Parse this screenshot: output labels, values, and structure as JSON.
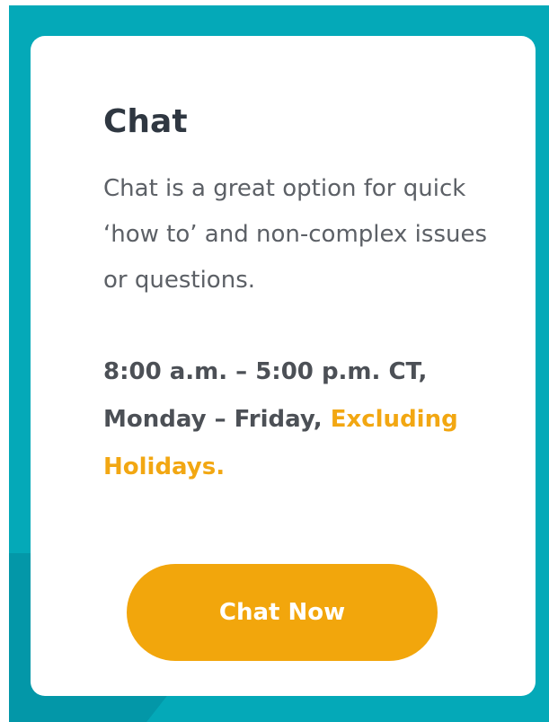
{
  "card": {
    "title": "Chat",
    "description": "Chat is a great option for quick ‘how to’ and non-complex issues or questions.",
    "hours_prefix": "8:00 a.m. – 5:00 p.m. CT, Monday – Friday, ",
    "hours_highlight": "Excluding Holidays.",
    "button_label": "Chat Now"
  },
  "colors": {
    "background": "#04a9b8",
    "accent": "#f2a60c",
    "title_text": "#2f3741",
    "body_text": "#5c6066"
  }
}
